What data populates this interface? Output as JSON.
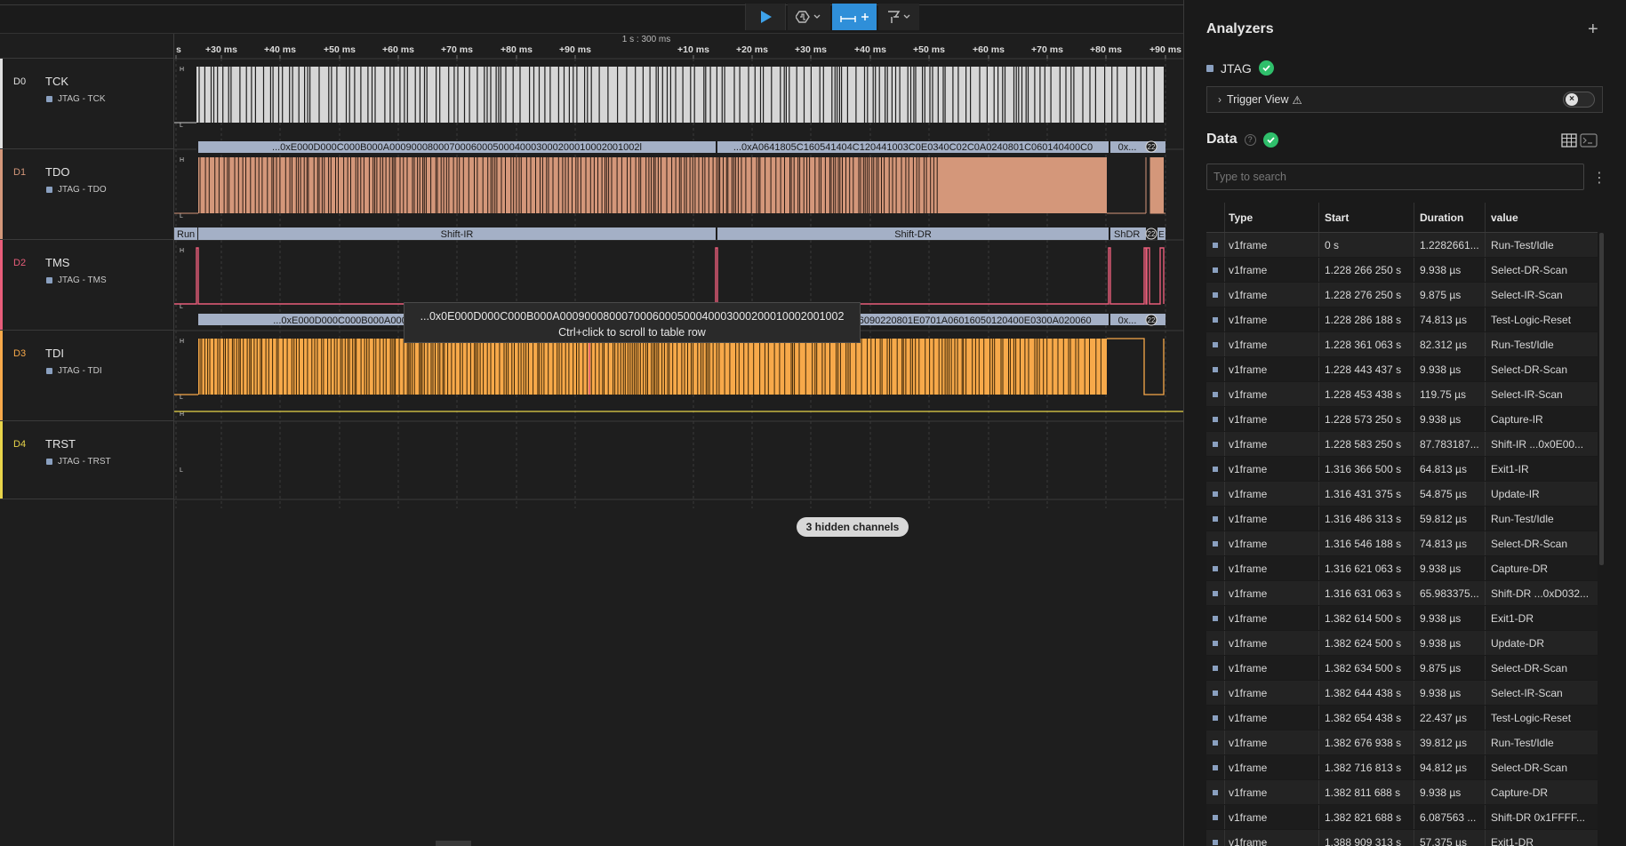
{
  "toolbar": {
    "measure_label": "3+",
    "colors": {
      "accent": "#2f8fd9"
    }
  },
  "timeline": {
    "ruler_center_label": "1 s : 300 ms",
    "ticks": [
      "s",
      "+30 ms",
      "+40 ms",
      "+50 ms",
      "+60 ms",
      "+70 ms",
      "+80 ms",
      "+90 ms",
      "+10 ms",
      "+20 ms",
      "+30 ms",
      "+40 ms",
      "+50 ms",
      "+60 ms",
      "+70 ms",
      "+80 ms",
      "+90 ms"
    ]
  },
  "channels": [
    {
      "num": "D0",
      "name": "TCK",
      "sub": "JTAG - TCK",
      "color": "#e0e0e0"
    },
    {
      "num": "D1",
      "name": "TDO",
      "sub": "JTAG - TDO",
      "color": "#d4977a"
    },
    {
      "num": "D2",
      "name": "TMS",
      "sub": "JTAG - TMS",
      "color": "#e85d7a"
    },
    {
      "num": "D3",
      "name": "TDI",
      "sub": "JTAG - TDI",
      "color": "#f7a94a"
    },
    {
      "num": "D4",
      "name": "TRST",
      "sub": "JTAG - TRST",
      "color": "#e8d44a"
    }
  ],
  "level_labels": {
    "high": "H",
    "low": "L"
  },
  "decoded": {
    "tdo_a": "...0xE000D000C000B000A0009000800070006000500040003000200010002001002l",
    "tdo_b": "...0xA0641805C160541404C120441003C0E0340C02C0A0240801C060140400C0",
    "tdo_c": "0x...",
    "tms_run": "Run",
    "tms_ir": "Shift-IR",
    "tms_dr": "Shift-DR",
    "tms_shdr": "ShDR",
    "tms_e": "E",
    "tdi_a": "...0xE000D000C000B000A0009000800070006000500040003000200010002001002",
    "tdi_b": "...0xD0320C02E0B02A0A026090220801E0701A06016050120400E0300A020060",
    "tdi_c": "0x...",
    "badge": "22"
  },
  "tooltip": {
    "line1": "...0x0E000D000C000B000A0009000800070006000500040003000200010002001002",
    "line2": "Ctrl+click to scroll to table row"
  },
  "hidden_channels": "3 hidden channels",
  "panel": {
    "analyzers_title": "Analyzers",
    "add_icon": "+",
    "analyzer_name": "JTAG",
    "trigger_view": "Trigger View",
    "trigger_warning": "⚠",
    "data_title": "Data",
    "search_placeholder": "Type to search",
    "columns": [
      "Type",
      "Start",
      "Duration",
      "value"
    ],
    "rows": [
      [
        "v1frame",
        "0 s",
        "1.2282661...",
        "Run-Test/Idle"
      ],
      [
        "v1frame",
        "1.228 266 250 s",
        "9.938 µs",
        "Select-DR-Scan"
      ],
      [
        "v1frame",
        "1.228 276 250 s",
        "9.875 µs",
        "Select-IR-Scan"
      ],
      [
        "v1frame",
        "1.228 286 188 s",
        "74.813 µs",
        "Test-Logic-Reset"
      ],
      [
        "v1frame",
        "1.228 361 063 s",
        "82.312 µs",
        "Run-Test/Idle"
      ],
      [
        "v1frame",
        "1.228 443 437 s",
        "9.938 µs",
        "Select-DR-Scan"
      ],
      [
        "v1frame",
        "1.228 453 438 s",
        "119.75 µs",
        "Select-IR-Scan"
      ],
      [
        "v1frame",
        "1.228 573 250 s",
        "9.938 µs",
        "Capture-IR"
      ],
      [
        "v1frame",
        "1.228 583 250 s",
        "87.783187...",
        "Shift-IR ...0x0E00..."
      ],
      [
        "v1frame",
        "1.316 366 500 s",
        "64.813 µs",
        "Exit1-IR"
      ],
      [
        "v1frame",
        "1.316 431 375 s",
        "54.875 µs",
        "Update-IR"
      ],
      [
        "v1frame",
        "1.316 486 313 s",
        "59.812 µs",
        "Run-Test/Idle"
      ],
      [
        "v1frame",
        "1.316 546 188 s",
        "74.813 µs",
        "Select-DR-Scan"
      ],
      [
        "v1frame",
        "1.316 621 063 s",
        "9.938 µs",
        "Capture-DR"
      ],
      [
        "v1frame",
        "1.316 631 063 s",
        "65.983375...",
        "Shift-DR ...0xD032..."
      ],
      [
        "v1frame",
        "1.382 614 500 s",
        "9.938 µs",
        "Exit1-DR"
      ],
      [
        "v1frame",
        "1.382 624 500 s",
        "9.938 µs",
        "Update-DR"
      ],
      [
        "v1frame",
        "1.382 634 500 s",
        "9.875 µs",
        "Select-DR-Scan"
      ],
      [
        "v1frame",
        "1.382 644 438 s",
        "9.938 µs",
        "Select-IR-Scan"
      ],
      [
        "v1frame",
        "1.382 654 438 s",
        "22.437 µs",
        "Test-Logic-Reset"
      ],
      [
        "v1frame",
        "1.382 676 938 s",
        "39.812 µs",
        "Run-Test/Idle"
      ],
      [
        "v1frame",
        "1.382 716 813 s",
        "94.812 µs",
        "Select-DR-Scan"
      ],
      [
        "v1frame",
        "1.382 811 688 s",
        "9.938 µs",
        "Capture-DR"
      ],
      [
        "v1frame",
        "1.382 821 688 s",
        "6.087563 ...",
        "Shift-DR 0x1FFFF..."
      ],
      [
        "v1frame",
        "1.388 909 313 s",
        "57.375 µs",
        "Exit1-DR"
      ]
    ]
  }
}
